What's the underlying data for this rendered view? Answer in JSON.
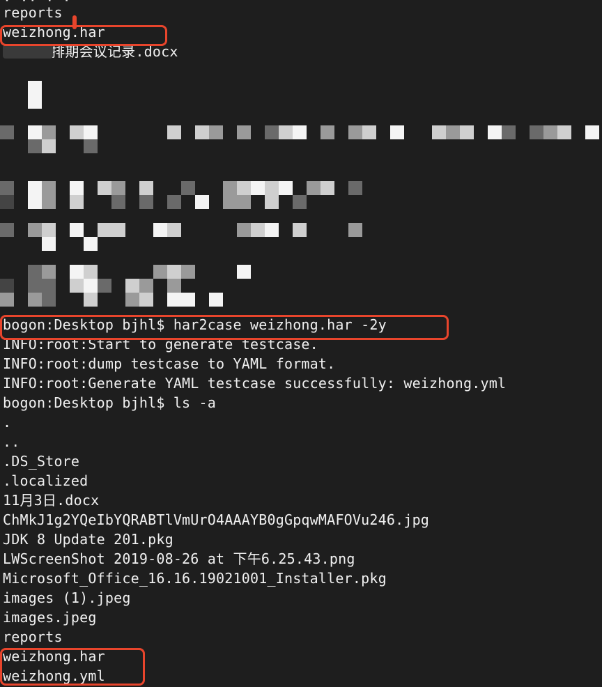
{
  "terminal": {
    "lines": [
      "reports",
      "weizhong.har",
      "~$  周排期会议记录.docx",
      "bogon:Desktop bjhl$ har2case weizhong.har -2y",
      "INFO:root:Start to generate testcase.",
      "INFO:root:dump testcase to YAML format.",
      "INFO:root:Generate YAML testcase successfully: weizhong.yml",
      "bogon:Desktop bjhl$ ls -a",
      ".",
      "..",
      ".DS_Store",
      ".localized",
      "11月3日.docx",
      "ChMkJ1g2YQeIbYQRABTlVmUrO4AAAYB0gGpqwMAFOVu246.jpg",
      "JDK 8 Update 201.pkg",
      "LWScreenShot 2019-08-26 at 下午6.25.43.png",
      "Microsoft_Office_16.16.19021001_Installer.pkg",
      "images (1).jpeg",
      "images.jpeg",
      "reports",
      "weizhong.har",
      "weizhong.yml"
    ]
  },
  "colors": {
    "background": "#1e1e1e",
    "text": "#f0f0f0",
    "highlight": "#e8452c"
  }
}
